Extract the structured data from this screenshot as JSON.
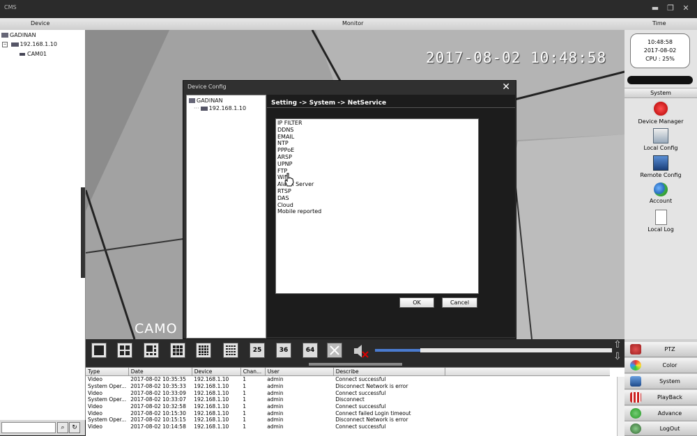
{
  "window": {
    "title": "CMS"
  },
  "columns": {
    "device": "Device",
    "monitor": "Monitor",
    "time": "Time"
  },
  "device_tree": {
    "root": "GADINAN",
    "device": "192.168.1.10",
    "camera": "CAM01"
  },
  "video": {
    "osd_timestamp": "2017-08-02 10:48:58",
    "camera_label": "CAMO"
  },
  "dialog": {
    "title": "Device Config",
    "close": "✕",
    "tree_root": "GADINAN",
    "tree_device": "192.168.1.10",
    "path": "Setting -> System -> NetService",
    "services": [
      "IP FILTER",
      "DDNS",
      "EMAIL",
      "NTP",
      "PPPoE",
      "ARSP",
      "UPNP",
      "FTP",
      "Wifi",
      "Alarm Server",
      "RTSP",
      "DAS",
      "Cloud",
      "Mobile reported"
    ],
    "ok": "OK",
    "cancel": "Cancel"
  },
  "toolbar": {
    "layouts": [
      "25",
      "36",
      "64"
    ]
  },
  "clock": {
    "time": "10:48:58",
    "date": "2017-08-02",
    "cpu": "CPU : 25%"
  },
  "system": {
    "header": "System",
    "items": [
      "Device Manager",
      "Local Config",
      "Remote Config",
      "Account",
      "Local Log"
    ]
  },
  "right_menu": [
    "PTZ",
    "Color",
    "System",
    "PlayBack",
    "Advance",
    "LogOut"
  ],
  "log": {
    "headers": [
      "Type",
      "Date",
      "Device",
      "Chan...",
      "User",
      "Describe"
    ],
    "rows": [
      [
        "Video",
        "2017-08-02 10:35:35",
        "192.168.1.10",
        "1",
        "admin",
        "Connect successful"
      ],
      [
        "System Oper...",
        "2017-08-02 10:35:33",
        "192.168.1.10",
        "1",
        "admin",
        "Disconnect Network is error"
      ],
      [
        "Video",
        "2017-08-02 10:33:09",
        "192.168.1.10",
        "1",
        "admin",
        "Connect successful"
      ],
      [
        "System Oper...",
        "2017-08-02 10:33:07",
        "192.168.1.10",
        "1",
        "admin",
        "Disconnect"
      ],
      [
        "Video",
        "2017-08-02 10:32:58",
        "192.168.1.10",
        "1",
        "admin",
        "Connect successful"
      ],
      [
        "Video",
        "2017-08-02 10:15:30",
        "192.168.1.10",
        "1",
        "admin",
        "Connect failed Login timeout"
      ],
      [
        "System Oper...",
        "2017-08-02 10:15:15",
        "192.168.1.10",
        "1",
        "admin",
        "Disconnect Network is error"
      ],
      [
        "Video",
        "2017-08-02 10:14:58",
        "192.168.1.10",
        "1",
        "admin",
        "Connect successful"
      ]
    ]
  }
}
